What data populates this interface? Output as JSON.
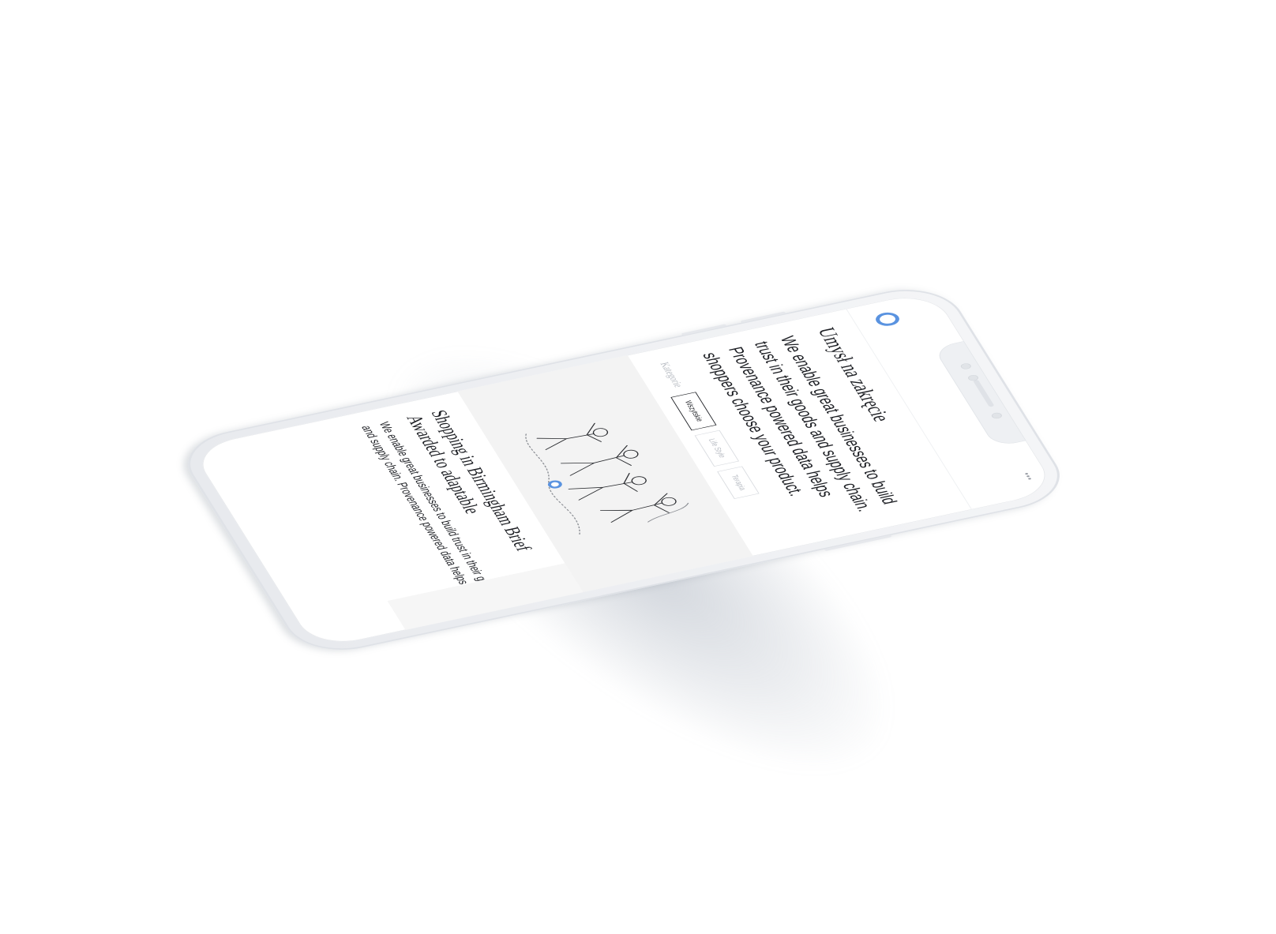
{
  "header": {
    "menu_icon": "more-dots-icon",
    "menu_glyph": "•••",
    "logo_icon": "ring-logo-icon"
  },
  "page": {
    "title": "Umysł na zakręcie",
    "intro": "We enable great businesses to build trust in their goods and supply chain. Provenance powered data helps shoppers choose your product."
  },
  "categories": {
    "label": "Kategorie",
    "items": [
      {
        "label": "Wszytskie",
        "active": true
      },
      {
        "label": "Life Style",
        "active": false
      },
      {
        "label": "Terapia",
        "active": false
      }
    ]
  },
  "card": {
    "image_icon": "dancing-people-illustration",
    "title": "Shopping in Birmingham Brief Awarded to adaptable",
    "text": "We enable great businesses to build trust in their goods and supply chain. Provenance powered data helps",
    "accent_color": "#5a93e0"
  }
}
